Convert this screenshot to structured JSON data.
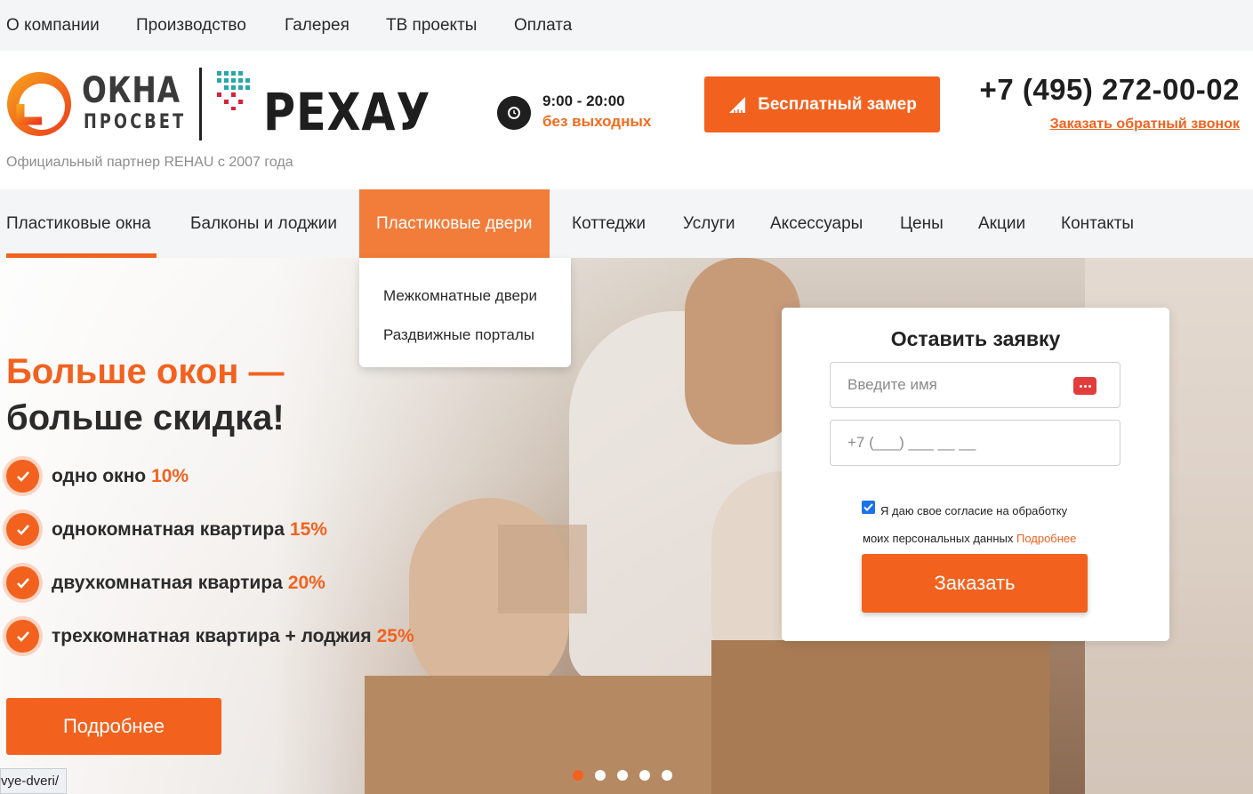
{
  "topnav": {
    "items": [
      "О компании",
      "Производство",
      "Галерея",
      "ТВ проекты",
      "Оплата"
    ]
  },
  "logo": {
    "line1": "ОКНА",
    "line2": "ПРОСВЕТ",
    "partner_word": "РЕХАУ"
  },
  "header": {
    "partner_text": "Официальный партнер REHAU с 2007 года",
    "hours": "9:00 - 20:00",
    "days": "без выходных",
    "measure_button": "Бесплатный замер",
    "phone": "+7 (495) 272-00-02",
    "callback_link": "Заказать обратный звонок"
  },
  "mainnav": {
    "items": [
      "Пластиковые окна",
      "Балконы и лоджии",
      "Пластиковые двери",
      "Коттеджи",
      "Услуги",
      "Аксессуары",
      "Цены",
      "Акции",
      "Контакты"
    ],
    "active": "Пластиковые двери"
  },
  "dropdown": {
    "items": [
      "Межкомнатные двери",
      "Раздвижные порталы"
    ]
  },
  "hero": {
    "headline_1": "Больше окон —",
    "headline_2": "больше скидка!",
    "bullets": [
      {
        "text": "одно окно",
        "percent": "10%"
      },
      {
        "text": "однокомнатная квартира",
        "percent": "15%"
      },
      {
        "text": "двухкомнатная квартира",
        "percent": "20%"
      },
      {
        "text": "трехкомнатная квартира + лоджия",
        "percent": "25%"
      }
    ],
    "more_button": "Подробнее",
    "slides_count": 5,
    "active_slide": 1
  },
  "form": {
    "title": "Оставить заявку",
    "name_placeholder": "Введите имя",
    "phone_placeholder": "+7 (___) ___ __ __",
    "consent_line1": "Я даю свое согласие на обработку",
    "consent_line2": "моих персональных данных",
    "consent_link": "Подробнее",
    "consent_checked": true,
    "submit": "Заказать"
  },
  "status_bar": {
    "url": "vye-dveri/"
  },
  "colors": {
    "accent": "#f2621e",
    "nav_active": "#f27c3a",
    "bar_bg": "#f4f5f6"
  }
}
